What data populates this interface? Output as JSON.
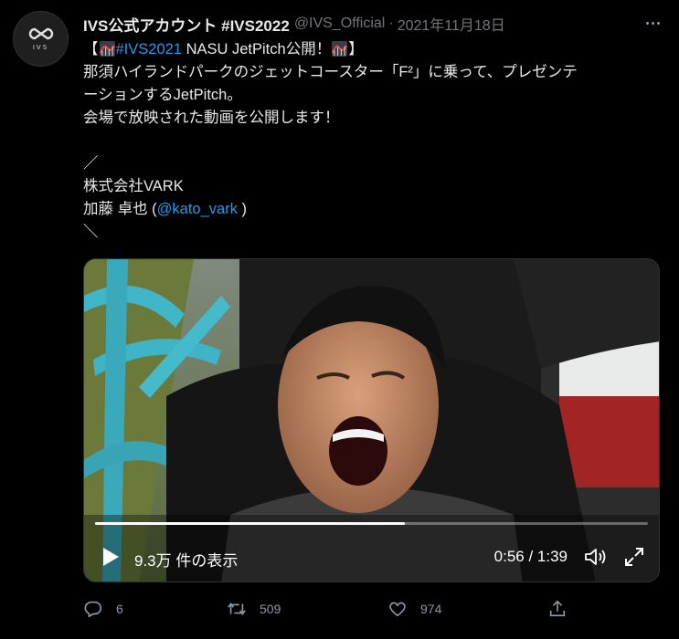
{
  "account": {
    "display_name": "IVS公式アカウント #IVS2022",
    "handle": "@IVS_Official",
    "separator": "·",
    "date": "2021年11月18日",
    "avatar_text": "IVS"
  },
  "tweet": {
    "line1_open": "【",
    "line1_hashtag": "#IVS2021",
    "line1_rest": " NASU JetPitch公開！",
    "line1_close": "】",
    "line2": "那須ハイランドパークのジェットコースター「F²」に乗って、プレゼンテ",
    "line3": "ーションするJetPitch。",
    "line4": "会場で放映された動画を公開します！",
    "line5": "",
    "line6": "／",
    "line7": "株式会社VARK",
    "line8_name": "加藤 卓也 (",
    "line8_mention": "@kato_vark",
    "line8_close": " )",
    "line9": "＼"
  },
  "video": {
    "views_count": "9.3万",
    "views_label": " 件の表示",
    "time": "0:56 / 1:39",
    "progress_fraction": 0.56
  },
  "actions": {
    "replies": "6",
    "retweets": "509",
    "likes": "974"
  },
  "colors": {
    "background": "#000000",
    "link": "#1d9bf0",
    "muted": "#71767b"
  },
  "icons": [
    "ivs-logo-icon",
    "more-icon",
    "roller-coaster-emoji-icon",
    "play-icon",
    "volume-icon",
    "fullscreen-icon",
    "reply-icon",
    "retweet-icon",
    "like-icon",
    "share-icon"
  ]
}
